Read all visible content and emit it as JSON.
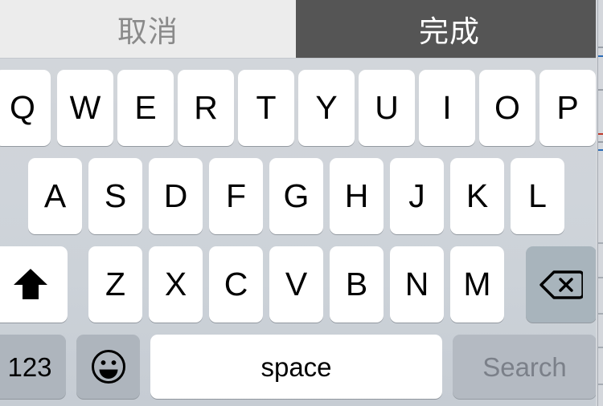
{
  "toolbar": {
    "cancel_label": "取消",
    "done_label": "完成",
    "cancel_bg": "#ececec",
    "cancel_color": "#8a8a8a",
    "done_bg": "#555555",
    "done_color": "#ffffff"
  },
  "keyboard": {
    "layout": "QWERTY",
    "language": "English",
    "shift_state": "active",
    "background": "#cfd4da",
    "key_bg": "#ffffff",
    "special_key_bg": "#aeb5bd",
    "row1": [
      {
        "label": "Q"
      },
      {
        "label": "W"
      },
      {
        "label": "E"
      },
      {
        "label": "R"
      },
      {
        "label": "T"
      },
      {
        "label": "Y"
      },
      {
        "label": "U"
      },
      {
        "label": "I"
      },
      {
        "label": "O"
      },
      {
        "label": "P"
      }
    ],
    "row2": [
      {
        "label": "A"
      },
      {
        "label": "S"
      },
      {
        "label": "D"
      },
      {
        "label": "F"
      },
      {
        "label": "G"
      },
      {
        "label": "H"
      },
      {
        "label": "J"
      },
      {
        "label": "K"
      },
      {
        "label": "L"
      }
    ],
    "row3": [
      {
        "label": "Z"
      },
      {
        "label": "X"
      },
      {
        "label": "C"
      },
      {
        "label": "V"
      },
      {
        "label": "B"
      },
      {
        "label": "N"
      },
      {
        "label": "M"
      }
    ],
    "shift_key": {
      "icon": "shift-arrow-icon",
      "label": ""
    },
    "delete_key": {
      "icon": "backspace-icon",
      "label": ""
    },
    "numeric_key": {
      "label": "123"
    },
    "emoji_key": {
      "icon": "emoji-smiley-icon",
      "label": ""
    },
    "space_key": {
      "label": "space"
    },
    "return_key": {
      "label": "Search",
      "color": "#7b8089",
      "bg": "#b4bac2"
    }
  }
}
